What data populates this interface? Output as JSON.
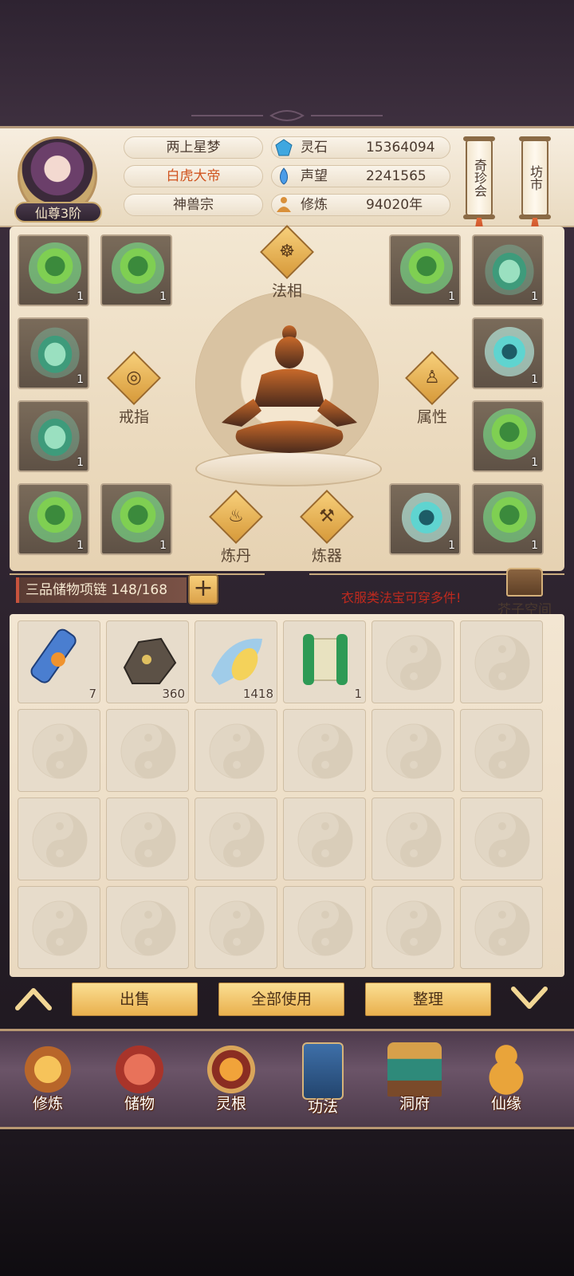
{
  "player": {
    "rank": "仙尊3阶",
    "name": "两上星梦",
    "title": "白虎大帝",
    "sect": "神兽宗"
  },
  "stats": [
    {
      "icon": "spirit-stone-icon",
      "label": "灵石",
      "value": "15364094"
    },
    {
      "icon": "prestige-icon",
      "label": "声望",
      "value": "2241565"
    },
    {
      "icon": "cultivation-icon",
      "label": "修炼",
      "value": "94020年"
    }
  ],
  "shortcuts": {
    "treasure_fair": "奇珍会",
    "market": "坊市"
  },
  "equipment": {
    "left": [
      {
        "type": "green",
        "count": "1"
      },
      {
        "type": "green",
        "count": "1"
      },
      {
        "type": "jade",
        "count": "1"
      },
      {
        "type": "jade",
        "count": "1"
      },
      {
        "type": "green",
        "count": "1"
      },
      {
        "type": "green",
        "count": "1"
      }
    ],
    "right": [
      {
        "type": "green",
        "count": "1"
      },
      {
        "type": "jade",
        "count": "1"
      },
      {
        "type": "cyan",
        "count": "1"
      },
      {
        "type": "green",
        "count": "1"
      },
      {
        "type": "cyan",
        "count": "1"
      },
      {
        "type": "green",
        "count": "1"
      }
    ]
  },
  "functions": {
    "faxiang": "法相",
    "ring": "戒指",
    "attributes": "属性",
    "alchemy": "炼丹",
    "forging": "炼器"
  },
  "bag": {
    "caption": "三品储物项链 148/168",
    "add_label": "+",
    "wear_hint": "衣服类法宝可穿多件!",
    "space_label": "芥子空间",
    "items": [
      {
        "kind": "scroll-blue",
        "count": "7"
      },
      {
        "kind": "ore",
        "count": "360"
      },
      {
        "kind": "crystal",
        "count": "1418"
      },
      {
        "kind": "scroll-green",
        "count": "1"
      }
    ],
    "total_slots": 24
  },
  "actions": {
    "sell": "出售",
    "use_all": "全部使用",
    "sort": "整理"
  },
  "nav": [
    {
      "label": "修炼",
      "icon": "cultivate-icon"
    },
    {
      "label": "储物",
      "icon": "storage-bag-icon"
    },
    {
      "label": "灵根",
      "icon": "spirit-root-icon"
    },
    {
      "label": "功法",
      "icon": "technique-book-icon"
    },
    {
      "label": "洞府",
      "icon": "cave-dwelling-icon"
    },
    {
      "label": "仙缘",
      "icon": "gourd-icon"
    }
  ],
  "colors": {
    "accent_gold": "#e9b04e",
    "hint_red": "#c02a1e"
  }
}
